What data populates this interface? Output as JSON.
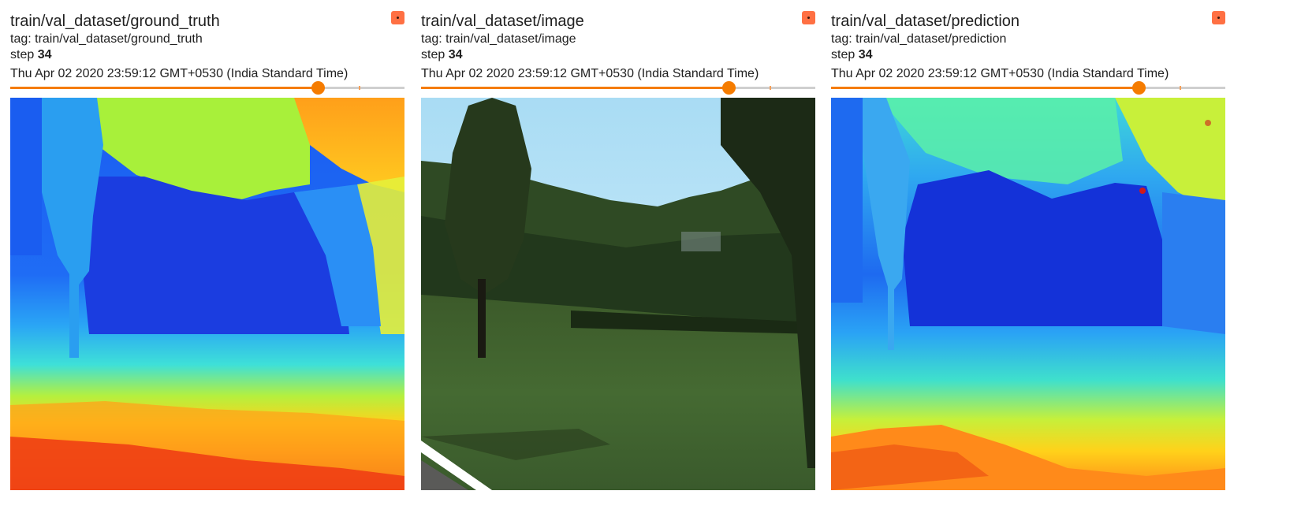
{
  "cards": [
    {
      "title": "train/val_dataset/ground_truth",
      "tag": "tag: train/val_dataset/ground_truth",
      "step_label": "step",
      "step_value": "34",
      "timestamp": "Thu Apr 02 2020 23:59:12 GMT+0530 (India Standard Time)",
      "slider_fraction": 0.78
    },
    {
      "title": "train/val_dataset/image",
      "tag": "tag: train/val_dataset/image",
      "step_label": "step",
      "step_value": "34",
      "timestamp": "Thu Apr 02 2020 23:59:12 GMT+0530 (India Standard Time)",
      "slider_fraction": 0.78
    },
    {
      "title": "train/val_dataset/prediction",
      "tag": "tag: train/val_dataset/prediction",
      "step_label": "step",
      "step_value": "34",
      "timestamp": "Thu Apr 02 2020 23:59:12 GMT+0530 (India Standard Time)",
      "slider_fraction": 0.78
    }
  ],
  "icons": {
    "expand": "fullscreen-icon"
  },
  "colors": {
    "accent": "#f57c00",
    "expand_button": "#ff7043"
  }
}
